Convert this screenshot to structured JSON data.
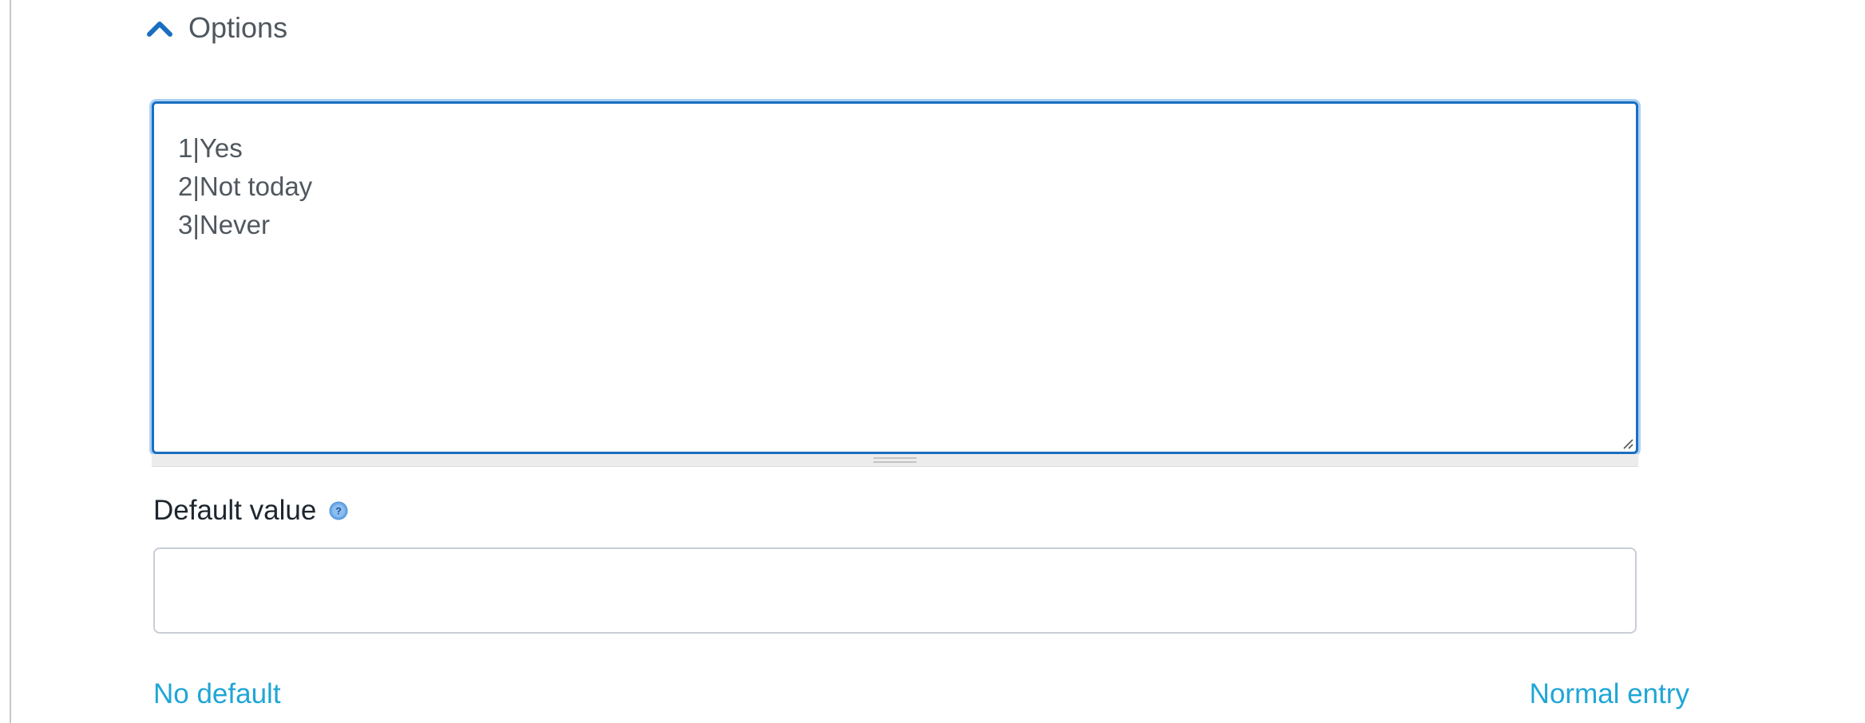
{
  "options_section": {
    "title": "Options",
    "expanded_icon": "chevron-up-icon",
    "textarea_value": "1|Yes\n2|Not today\n3|Never"
  },
  "default_value": {
    "label": "Default value",
    "help_icon": "question-circle-icon",
    "value": "",
    "placeholder": ""
  },
  "links": {
    "no_default": "No default",
    "normal_entry": "Normal entry"
  },
  "colors": {
    "accent": "#1a6ec0",
    "link": "#1fa6d6",
    "focus_glow": "#a9d0f5"
  }
}
